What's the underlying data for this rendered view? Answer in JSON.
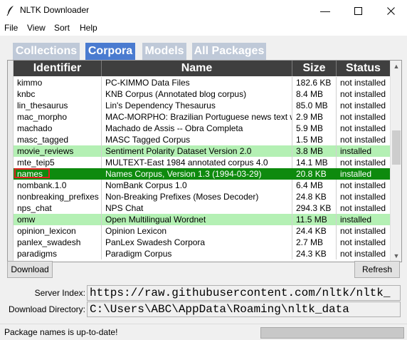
{
  "window": {
    "title": "NLTK Downloader"
  },
  "menu": [
    "File",
    "View",
    "Sort",
    "Help"
  ],
  "tabs": [
    {
      "label": "Collections",
      "active": false
    },
    {
      "label": "Corpora",
      "active": true
    },
    {
      "label": "Models",
      "active": false
    },
    {
      "label": "All Packages",
      "active": false
    }
  ],
  "table": {
    "columns": [
      "Identifier",
      "Name",
      "Size",
      "Status"
    ],
    "rows": [
      {
        "id": "kimmo",
        "name": "PC-KIMMO Data Files",
        "size": "182.6 KB",
        "status": "not installed"
      },
      {
        "id": "knbc",
        "name": "KNB Corpus (Annotated blog corpus)",
        "size": "8.4 MB",
        "status": "not installed"
      },
      {
        "id": "lin_thesaurus",
        "name": "Lin's Dependency Thesaurus",
        "size": "85.0 MB",
        "status": "not installed"
      },
      {
        "id": "mac_morpho",
        "name": "MAC-MORPHO: Brazilian Portuguese news text wi",
        "size": "2.9 MB",
        "status": "not installed"
      },
      {
        "id": "machado",
        "name": "Machado de Assis -- Obra Completa",
        "size": "5.9 MB",
        "status": "not installed"
      },
      {
        "id": "masc_tagged",
        "name": "MASC Tagged Corpus",
        "size": "1.5 MB",
        "status": "not installed"
      },
      {
        "id": "movie_reviews",
        "name": "Sentiment Polarity Dataset Version 2.0",
        "size": "3.8 MB",
        "status": "installed"
      },
      {
        "id": "mte_teip5",
        "name": "MULTEXT-East 1984 annotated corpus 4.0",
        "size": "14.1 MB",
        "status": "not installed"
      },
      {
        "id": "names",
        "name": "Names Corpus, Version 1.3 (1994-03-29)",
        "size": "20.8 KB",
        "status": "installed",
        "selected": true
      },
      {
        "id": "nombank.1.0",
        "name": "NomBank Corpus 1.0",
        "size": "6.4 MB",
        "status": "not installed"
      },
      {
        "id": "nonbreaking_prefixes",
        "name": "Non-Breaking Prefixes (Moses Decoder)",
        "size": "24.8 KB",
        "status": "not installed"
      },
      {
        "id": "nps_chat",
        "name": "NPS Chat",
        "size": "294.3 KB",
        "status": "not installed"
      },
      {
        "id": "omw",
        "name": "Open Multilingual Wordnet",
        "size": "11.5 MB",
        "status": "installed"
      },
      {
        "id": "opinion_lexicon",
        "name": "Opinion Lexicon",
        "size": "24.4 KB",
        "status": "not installed"
      },
      {
        "id": "panlex_swadesh",
        "name": "PanLex Swadesh Corpora",
        "size": "2.7 MB",
        "status": "not installed"
      },
      {
        "id": "paradigms",
        "name": "Paradigm Corpus",
        "size": "24.3 KB",
        "status": "not installed"
      }
    ]
  },
  "buttons": {
    "download": "Download",
    "refresh": "Refresh"
  },
  "info": {
    "server_label": "Server Index:",
    "server_value": "https://raw.githubusercontent.com/nltk/nltk_",
    "dir_label": "Download Directory:",
    "dir_value": "C:\\Users\\ABC\\AppData\\Roaming\\nltk_data"
  },
  "status": {
    "message": "Package names is up-to-date!"
  },
  "colors": {
    "selected_row": "#0e8a0e",
    "installed_row": "#b4f0b4",
    "active_tab": "#4a7bd0",
    "inactive_tab": "#bfc9d8",
    "header": "#3f3f3f"
  }
}
